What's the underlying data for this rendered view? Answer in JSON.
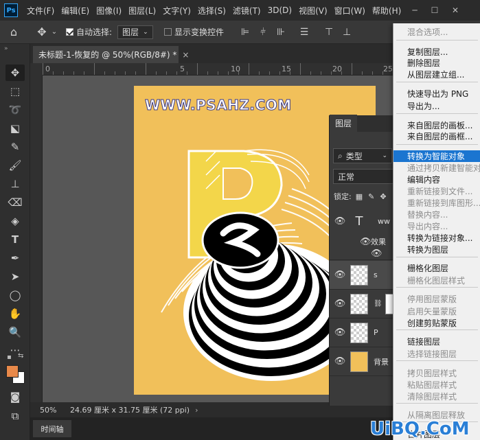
{
  "app": {
    "logo": "Ps"
  },
  "menubar": {
    "items": [
      "文件(F)",
      "编辑(E)",
      "图像(I)",
      "图层(L)",
      "文字(Y)",
      "选择(S)",
      "滤镜(T)",
      "3D(D)",
      "视图(V)",
      "窗口(W)",
      "帮助(H)"
    ]
  },
  "options": {
    "auto_select_label": "自动选择:",
    "auto_select_checked": true,
    "target_value": "图层",
    "show_transform_label": "显示变换控件",
    "show_transform_checked": false
  },
  "document": {
    "tab_title": "未标题-1-恢复的 @ 50%(RGB/8#) *",
    "close_symbol": "×",
    "zoom": "50%",
    "doc_size": "24.69 厘米 x 31.75 厘米 (72 ppi)",
    "watermark": "WWW.PSAHZ.COM"
  },
  "ruler": {
    "h_labels": [
      "0",
      "5",
      "10",
      "15",
      "20",
      "25"
    ]
  },
  "timeline": {
    "label": "时间轴"
  },
  "layers_panel": {
    "tab": "图层",
    "filter_kind": "类型",
    "blend_mode": "正常",
    "lock_label": "锁定:",
    "layers": [
      {
        "name": "ww",
        "kind": "text"
      },
      {
        "name": "效果",
        "kind": "effects"
      },
      {
        "name": "s",
        "kind": "layer"
      },
      {
        "name": "",
        "kind": "mask"
      },
      {
        "name": "P",
        "kind": "layer"
      },
      {
        "name": "背景",
        "kind": "background"
      }
    ]
  },
  "context_menu": {
    "items": [
      {
        "label": "混合选项...",
        "state": "disabled"
      },
      {
        "label": "复制图层...",
        "state": "enabled"
      },
      {
        "label": "删除图层",
        "state": "enabled"
      },
      {
        "label": "从图层建立组...",
        "state": "enabled"
      },
      {
        "label": "快速导出为 PNG",
        "state": "enabled"
      },
      {
        "label": "导出为...",
        "state": "enabled"
      },
      {
        "label": "来自图层的画板...",
        "state": "enabled"
      },
      {
        "label": "来自图层的画框...",
        "state": "enabled"
      },
      {
        "label": "转换为智能对象",
        "state": "highlighted"
      },
      {
        "label": "通过拷贝新建智能对",
        "state": "disabled"
      },
      {
        "label": "编辑内容",
        "state": "enabled"
      },
      {
        "label": "重新链接到文件...",
        "state": "disabled"
      },
      {
        "label": "重新链接到库图形...",
        "state": "disabled"
      },
      {
        "label": "替换内容...",
        "state": "disabled"
      },
      {
        "label": "导出内容...",
        "state": "disabled"
      },
      {
        "label": "转换为链接对象...",
        "state": "enabled"
      },
      {
        "label": "转换为图层",
        "state": "enabled"
      },
      {
        "label": "栅格化图层",
        "state": "enabled"
      },
      {
        "label": "栅格化图层样式",
        "state": "disabled"
      },
      {
        "label": "停用图层蒙版",
        "state": "disabled"
      },
      {
        "label": "启用矢量蒙版",
        "state": "disabled"
      },
      {
        "label": "创建剪贴蒙版",
        "state": "enabled"
      },
      {
        "label": "链接图层",
        "state": "enabled"
      },
      {
        "label": "选择链接图层",
        "state": "disabled"
      },
      {
        "label": "拷贝图层样式",
        "state": "disabled"
      },
      {
        "label": "粘贴图层样式",
        "state": "disabled"
      },
      {
        "label": "清除图层样式",
        "state": "disabled"
      },
      {
        "label": "从隔离图层释放",
        "state": "disabled"
      },
      {
        "label": "合并图层",
        "state": "enabled"
      }
    ]
  },
  "brand": {
    "text": "UiBQ.CoM"
  },
  "colors": {
    "accent": "#1b75d0",
    "canvas_bg": "#f1c05a",
    "foreground_swatch": "#e8894a",
    "background_swatch": "#ffffff"
  }
}
